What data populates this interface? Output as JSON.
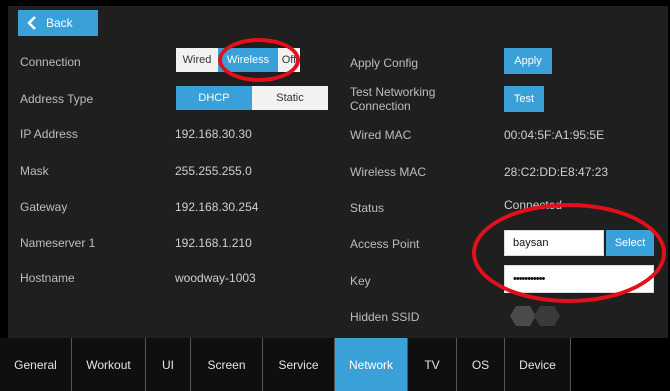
{
  "header": {
    "back_label": "Back"
  },
  "left": {
    "connection": {
      "label": "Connection",
      "options": [
        "Wired",
        "Wireless",
        "Off"
      ],
      "selected": "Wireless"
    },
    "address_type": {
      "label": "Address Type",
      "options": [
        "DHCP",
        "Static"
      ],
      "selected": "DHCP"
    },
    "ip_address": {
      "label": "IP Address",
      "value": "192.168.30.30"
    },
    "mask": {
      "label": "Mask",
      "value": "255.255.255.0"
    },
    "gateway": {
      "label": "Gateway",
      "value": "192.168.30.254"
    },
    "nameserver": {
      "label": "Nameserver 1",
      "value": "192.168.1.210"
    },
    "hostname": {
      "label": "Hostname",
      "value": "woodway-1003"
    }
  },
  "right": {
    "apply_config": {
      "label": "Apply Config",
      "button": "Apply"
    },
    "test_networking": {
      "label": "Test Networking Connection",
      "button": "Test"
    },
    "wired_mac": {
      "label": "Wired MAC",
      "value": "00:04:5F:A1:95:5E"
    },
    "wireless_mac": {
      "label": "Wireless MAC",
      "value": "28:C2:DD:E8:47:23"
    },
    "status": {
      "label": "Status",
      "value": "Connected"
    },
    "access_point": {
      "label": "Access Point",
      "value": "baysan",
      "button": "Select"
    },
    "key": {
      "label": "Key",
      "value": "•••••••••••"
    },
    "hidden_ssid": {
      "label": "Hidden SSID"
    }
  },
  "tabs": [
    {
      "label": "General"
    },
    {
      "label": "Workout"
    },
    {
      "label": "UI"
    },
    {
      "label": "Screen"
    },
    {
      "label": "Service"
    },
    {
      "label": "Network",
      "active": true
    },
    {
      "label": "TV"
    },
    {
      "label": "OS"
    },
    {
      "label": "Device"
    }
  ],
  "colors": {
    "accent": "#3aa0d8",
    "annotation": "#e3101b",
    "background": "#1f1f1f"
  },
  "icons": {
    "back": "chevron-left-icon",
    "toggle": "hexagon-toggle-icon"
  }
}
